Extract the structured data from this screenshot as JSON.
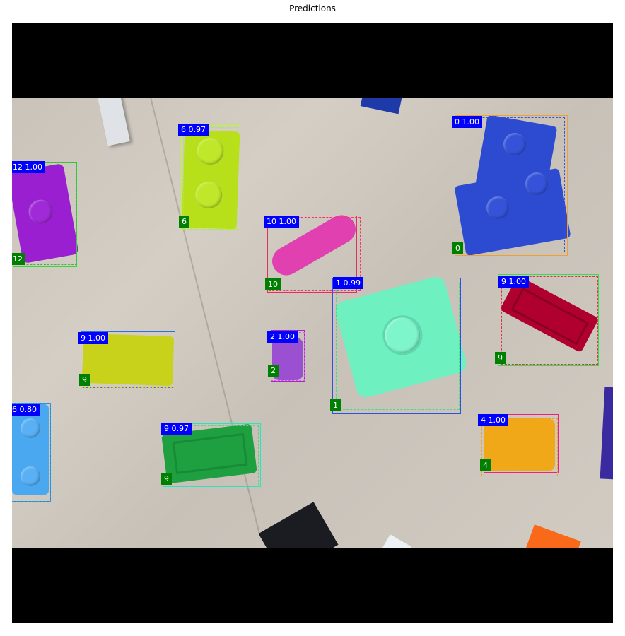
{
  "title": "Predictions",
  "predictions": [
    {
      "score_label": "0 1.00",
      "class_label": "0",
      "color": "#2d4bd1",
      "box_color": "#f0a030",
      "gt_color": "#3050e0"
    },
    {
      "score_label": "6 0.97",
      "class_label": "6",
      "color": "#b7e01a",
      "box_color": "#c4f040",
      "gt_color": "#a0ee50"
    },
    {
      "score_label": "12 1.00",
      "class_label": "12",
      "color": "#9a1fd0",
      "box_color": "#40d040",
      "gt_color": "#30c030"
    },
    {
      "score_label": "10 1.00",
      "class_label": "10",
      "color": "#e040b0",
      "box_color": "#e03060",
      "gt_color": "#ff3060"
    },
    {
      "score_label": "1 0.99",
      "class_label": "1",
      "color": "#6ef0c0",
      "box_color": "#3050e0",
      "gt_color": "#40e080"
    },
    {
      "score_label": "9 1.00",
      "class_label": "9",
      "color": "#b00030",
      "box_color": "#30e050",
      "gt_color": "#e03040"
    },
    {
      "score_label": "9 1.00",
      "class_label": "9",
      "color": "#c8d21a",
      "box_color": "#3070d0",
      "gt_color": "#f0d020"
    },
    {
      "score_label": "2 1.00",
      "class_label": "2",
      "color": "#9a50d0",
      "box_color": "#b020d0",
      "gt_color": "#d060e0"
    },
    {
      "score_label": "6 0.80",
      "class_label": "6",
      "color": "#4aa8f0",
      "box_color": "#2080f0",
      "gt_color": "#30a0d0"
    },
    {
      "score_label": "9 0.97",
      "class_label": "9",
      "color": "#1fa040",
      "box_color": "#30e0c0",
      "gt_color": "#40e080"
    },
    {
      "score_label": "4 1.00",
      "class_label": "4",
      "color": "#f0a818",
      "box_color": "#f02080",
      "gt_color": "#f0a020"
    }
  ]
}
